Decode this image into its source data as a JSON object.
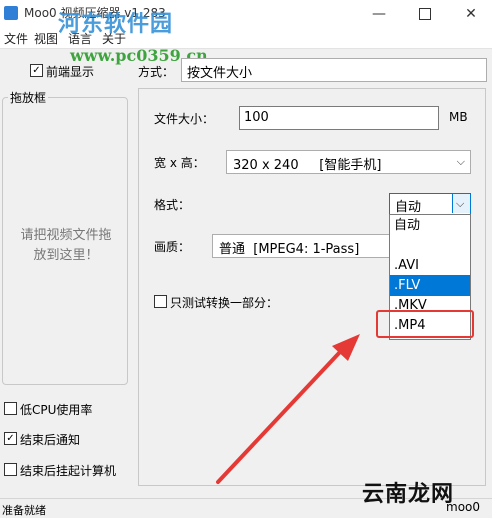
{
  "window": {
    "title": "Moo0 视频压缩器 v1.283"
  },
  "menu": {
    "items": [
      "文件",
      "视图",
      "语言",
      "关于"
    ]
  },
  "watermark": {
    "line1": "河东软件园",
    "line2": "www.pc0359.cn",
    "corner": "云南龙网"
  },
  "left": {
    "always_on_top": {
      "label": "前端显示",
      "checked": true
    },
    "dropzone": {
      "title": "拖放框",
      "hint_line1": "请把视频文件拖",
      "hint_line2": "放到这里！"
    },
    "options": [
      {
        "label": "低CPU使用率",
        "checked": false
      },
      {
        "label": "结束后通知",
        "checked": true
      },
      {
        "label": "结束后挂起计算机",
        "checked": false
      }
    ]
  },
  "method": {
    "label": "方式：",
    "value": "按文件大小"
  },
  "form": {
    "filesize": {
      "label": "文件大小：",
      "value": "100",
      "unit": "MB"
    },
    "resolution": {
      "label": "宽 x 高：",
      "value": "320 x 240     [智能手机]"
    },
    "format": {
      "label": "格式：",
      "value": "自动",
      "options": [
        "自动",
        ".AVI",
        ".FLV",
        ".MKV",
        ".MP4"
      ],
      "selected_option": ".FLV",
      "highlighted_option": ".MP4"
    },
    "quality": {
      "label": "画质：",
      "value": "普通  [MPEG4: 1-Pass]"
    },
    "test_part": {
      "label": "只测试转换一部分：",
      "checked": false
    }
  },
  "status": {
    "left": "准备就绪",
    "right": "moo0"
  },
  "colors": {
    "selection": "#0078d7",
    "annotation": "#e53935"
  }
}
